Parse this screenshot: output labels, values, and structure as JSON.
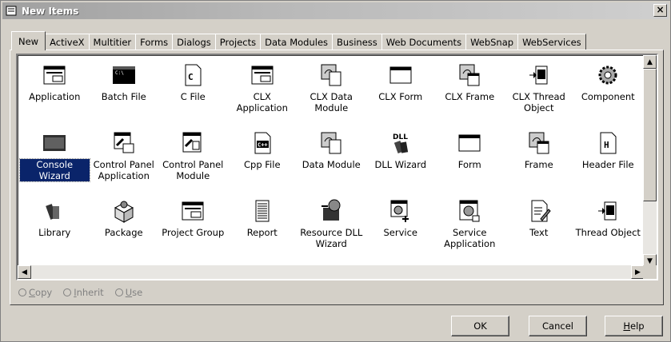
{
  "window": {
    "title": "New Items",
    "close_label": "×"
  },
  "tabs": [
    {
      "label": "New",
      "active": true
    },
    {
      "label": "ActiveX"
    },
    {
      "label": "Multitier"
    },
    {
      "label": "Forms"
    },
    {
      "label": "Dialogs"
    },
    {
      "label": "Projects"
    },
    {
      "label": "Data Modules"
    },
    {
      "label": "Business"
    },
    {
      "label": "Web Documents"
    },
    {
      "label": "WebSnap"
    },
    {
      "label": "WebServices"
    }
  ],
  "items": [
    {
      "label": "Application",
      "icon": "window"
    },
    {
      "label": "Batch File",
      "icon": "console"
    },
    {
      "label": "C File",
      "icon": "c-doc"
    },
    {
      "label": "CLX Application",
      "icon": "window"
    },
    {
      "label": "CLX Data Module",
      "icon": "datamodule"
    },
    {
      "label": "CLX Form",
      "icon": "form"
    },
    {
      "label": "CLX Frame",
      "icon": "frame"
    },
    {
      "label": "CLX Thread Object",
      "icon": "thread"
    },
    {
      "label": "Component",
      "icon": "gear"
    },
    {
      "label": "Console Wizard",
      "icon": "console-gray",
      "selected": true
    },
    {
      "label": "Control Panel Application",
      "icon": "cpl"
    },
    {
      "label": "Control Panel Module",
      "icon": "cpl-mod"
    },
    {
      "label": "Cpp File",
      "icon": "cpp-doc"
    },
    {
      "label": "Data Module",
      "icon": "datamodule"
    },
    {
      "label": "DLL Wizard",
      "icon": "dll"
    },
    {
      "label": "Form",
      "icon": "form"
    },
    {
      "label": "Frame",
      "icon": "frame"
    },
    {
      "label": "Header File",
      "icon": "h-doc"
    },
    {
      "label": "Library",
      "icon": "books"
    },
    {
      "label": "Package",
      "icon": "package"
    },
    {
      "label": "Project Group",
      "icon": "window"
    },
    {
      "label": "Report",
      "icon": "report"
    },
    {
      "label": "Resource DLL Wizard",
      "icon": "resource"
    },
    {
      "label": "Service",
      "icon": "service"
    },
    {
      "label": "Service Application",
      "icon": "service-app"
    },
    {
      "label": "Text",
      "icon": "text"
    },
    {
      "label": "Thread Object",
      "icon": "thread"
    }
  ],
  "options": [
    {
      "label": "Copy",
      "accel": "C",
      "rest": "opy"
    },
    {
      "label": "Inherit",
      "accel": "I",
      "rest": "nherit"
    },
    {
      "label": "Use",
      "accel": "U",
      "rest": "se"
    }
  ],
  "buttons": {
    "ok": "OK",
    "cancel": "Cancel",
    "help": "Help",
    "help_accel": "H",
    "help_rest": "elp"
  }
}
